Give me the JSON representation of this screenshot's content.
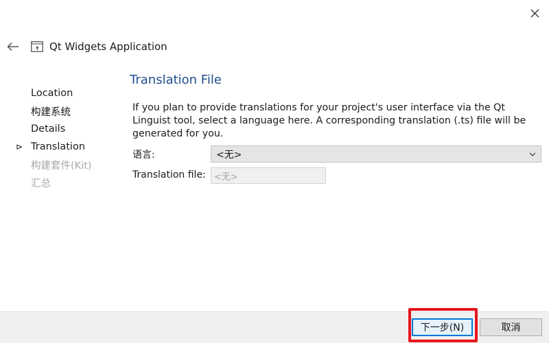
{
  "window": {
    "close_icon": "close-icon"
  },
  "header": {
    "back_icon": "back-arrow-icon",
    "app_icon": "app-window-icon",
    "title": "Qt Widgets Application"
  },
  "sidebar": {
    "current_marker": "⊳",
    "items": [
      {
        "label": "Location",
        "state": "done"
      },
      {
        "label": "构建系统",
        "state": "done"
      },
      {
        "label": "Details",
        "state": "done"
      },
      {
        "label": "Translation",
        "state": "current"
      },
      {
        "label": "构建套件(Kit)",
        "state": "pending"
      },
      {
        "label": "汇总",
        "state": "pending"
      }
    ]
  },
  "main": {
    "title": "Translation File",
    "description": "If you plan to provide translations for your project's user interface via the Qt Linguist tool, select a language here. A corresponding translation (.ts) file will be generated for you.",
    "language_label": "语言:",
    "language_value": "<无>",
    "translation_file_label": "Translation file:",
    "translation_file_value": "<无>"
  },
  "footer": {
    "next_label": "下一步(N)",
    "cancel_label": "取消"
  },
  "colors": {
    "title": "#1f4f8f",
    "highlight": "#e8141c",
    "focus": "#0078d7"
  }
}
